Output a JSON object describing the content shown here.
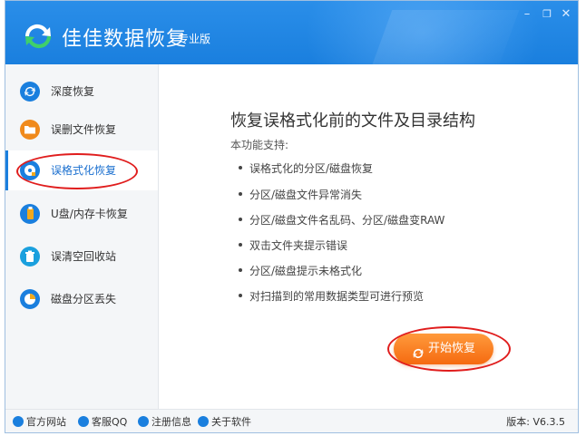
{
  "window": {
    "title": "佳佳数据恢复",
    "edition": "专业版",
    "controls": {
      "minimize": "–",
      "restore": "❐",
      "close": "✕"
    }
  },
  "sidebar": {
    "items": [
      {
        "label": "深度恢复",
        "icon": "refresh-icon",
        "color": "#1a7fde"
      },
      {
        "label": "误删文件恢复",
        "icon": "folder-icon",
        "color": "#f08a1c"
      },
      {
        "label": "误格式化恢复",
        "icon": "disk-icon",
        "color": "#1a7fde",
        "active": true
      },
      {
        "label": "U盘/内存卡恢复",
        "icon": "usb-icon",
        "color": "#f0a81c"
      },
      {
        "label": "误清空回收站",
        "icon": "recycle-bin-icon",
        "color": "#1aa0de"
      },
      {
        "label": "磁盘分区丢失",
        "icon": "pie-chart-icon",
        "color": "#1a7fde"
      }
    ]
  },
  "content": {
    "title": "恢复误格式化前的文件及目录结构",
    "subtitle": "本功能支持:",
    "features": [
      "误格式化的分区/磁盘恢复",
      "分区/磁盘文件异常消失",
      "分区/磁盘文件名乱码、分区/磁盘变RAW",
      "双击文件夹提示错误",
      "分区/磁盘提示未格式化",
      "对扫描到的常用数据类型可进行预览"
    ],
    "start_button": "开始恢复"
  },
  "statusbar": {
    "links": [
      {
        "label": "官方网站",
        "icon": "home-icon"
      },
      {
        "label": "客服QQ",
        "icon": "qq-icon"
      },
      {
        "label": "注册信息",
        "icon": "user-icon"
      },
      {
        "label": "关于软件",
        "icon": "info-icon"
      }
    ],
    "version": "版本: V6.3.5"
  },
  "colors": {
    "brand_blue": "#1a7fde",
    "start_orange": "#f56a10",
    "annotation_red": "#e01d1d"
  }
}
